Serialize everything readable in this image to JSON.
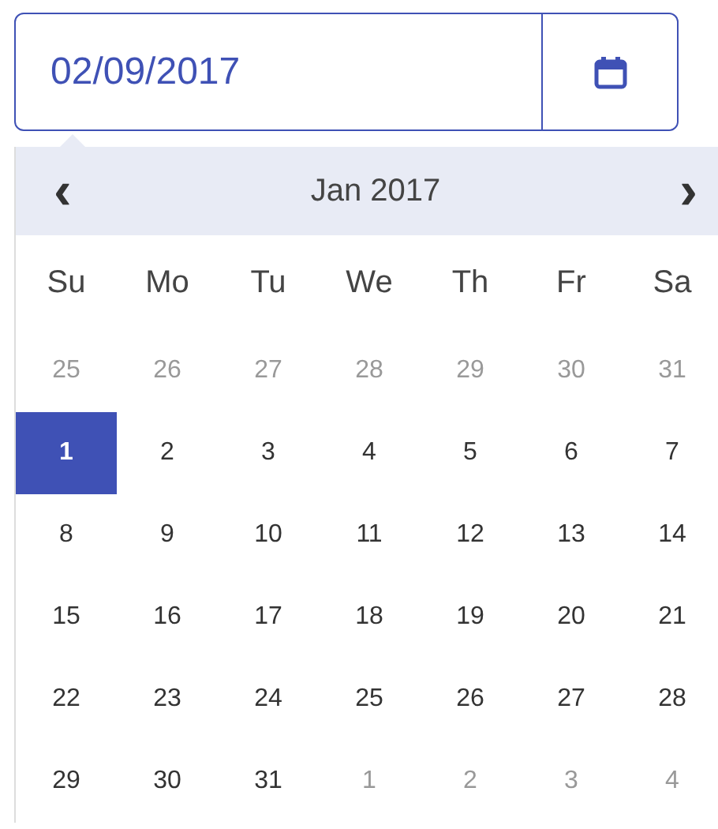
{
  "date_field": {
    "value": "02/09/2017"
  },
  "calendar": {
    "prev": "‹",
    "next": "›",
    "month_label": "Jan 2017",
    "weekdays": [
      "Su",
      "Mo",
      "Tu",
      "We",
      "Th",
      "Fr",
      "Sa"
    ],
    "weeks": [
      [
        {
          "day": "25",
          "outside": true,
          "selected": false
        },
        {
          "day": "26",
          "outside": true,
          "selected": false
        },
        {
          "day": "27",
          "outside": true,
          "selected": false
        },
        {
          "day": "28",
          "outside": true,
          "selected": false
        },
        {
          "day": "29",
          "outside": true,
          "selected": false
        },
        {
          "day": "30",
          "outside": true,
          "selected": false
        },
        {
          "day": "31",
          "outside": true,
          "selected": false
        }
      ],
      [
        {
          "day": "1",
          "outside": false,
          "selected": true
        },
        {
          "day": "2",
          "outside": false,
          "selected": false
        },
        {
          "day": "3",
          "outside": false,
          "selected": false
        },
        {
          "day": "4",
          "outside": false,
          "selected": false
        },
        {
          "day": "5",
          "outside": false,
          "selected": false
        },
        {
          "day": "6",
          "outside": false,
          "selected": false
        },
        {
          "day": "7",
          "outside": false,
          "selected": false
        }
      ],
      [
        {
          "day": "8",
          "outside": false,
          "selected": false
        },
        {
          "day": "9",
          "outside": false,
          "selected": false
        },
        {
          "day": "10",
          "outside": false,
          "selected": false
        },
        {
          "day": "11",
          "outside": false,
          "selected": false
        },
        {
          "day": "12",
          "outside": false,
          "selected": false
        },
        {
          "day": "13",
          "outside": false,
          "selected": false
        },
        {
          "day": "14",
          "outside": false,
          "selected": false
        }
      ],
      [
        {
          "day": "15",
          "outside": false,
          "selected": false
        },
        {
          "day": "16",
          "outside": false,
          "selected": false
        },
        {
          "day": "17",
          "outside": false,
          "selected": false
        },
        {
          "day": "18",
          "outside": false,
          "selected": false
        },
        {
          "day": "19",
          "outside": false,
          "selected": false
        },
        {
          "day": "20",
          "outside": false,
          "selected": false
        },
        {
          "day": "21",
          "outside": false,
          "selected": false
        }
      ],
      [
        {
          "day": "22",
          "outside": false,
          "selected": false
        },
        {
          "day": "23",
          "outside": false,
          "selected": false
        },
        {
          "day": "24",
          "outside": false,
          "selected": false
        },
        {
          "day": "25",
          "outside": false,
          "selected": false
        },
        {
          "day": "26",
          "outside": false,
          "selected": false
        },
        {
          "day": "27",
          "outside": false,
          "selected": false
        },
        {
          "day": "28",
          "outside": false,
          "selected": false
        }
      ],
      [
        {
          "day": "29",
          "outside": false,
          "selected": false
        },
        {
          "day": "30",
          "outside": false,
          "selected": false
        },
        {
          "day": "31",
          "outside": false,
          "selected": false
        },
        {
          "day": "1",
          "outside": true,
          "selected": false
        },
        {
          "day": "2",
          "outside": true,
          "selected": false
        },
        {
          "day": "3",
          "outside": true,
          "selected": false
        },
        {
          "day": "4",
          "outside": true,
          "selected": false
        }
      ]
    ]
  }
}
